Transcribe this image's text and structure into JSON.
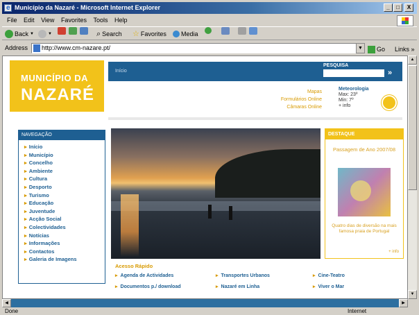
{
  "window": {
    "title": "Município da Nazaré - Microsoft Internet Explorer",
    "controls": [
      "_",
      "□",
      "X"
    ]
  },
  "menu": [
    "File",
    "Edit",
    "View",
    "Favorites",
    "Tools",
    "Help"
  ],
  "toolbar": {
    "back": "Back",
    "search": "Search",
    "favorites": "Favorites",
    "media": "Media"
  },
  "address": {
    "label": "Address",
    "url": "http://www.cm-nazare.pt/",
    "go": "Go",
    "links": "Links"
  },
  "status": {
    "text": "Done",
    "zone": "Internet"
  },
  "site": {
    "logo_line1": "MUNICÍPIO DA",
    "logo_line2": "NAZARÉ",
    "breadcrumb": "Início",
    "search_label": "PESQUISA",
    "search_go": "»",
    "top_links": [
      "Mapas",
      "Formulários Online",
      "Câmaras Online"
    ],
    "weather": {
      "title": "Meteorologia",
      "max": "Max: 23º",
      "min": "Min: 7º",
      "more": "+ info"
    },
    "nav_header": "NAVEGAÇÃO",
    "nav_items": [
      "Início",
      "Município",
      "Concelho",
      "Ambiente",
      "Cultura",
      "Desporto",
      "Turismo",
      "Educação",
      "Juventude",
      "Acção Social",
      "Colectividades",
      "Notícias",
      "Informações",
      "Contactos",
      "Galeria de Imagens"
    ],
    "destaque": {
      "header": "DESTAQUE",
      "title": "Passagem de Ano 2007/08",
      "desc": "Quatro dias de diversão na mais famosa praia de Portugal",
      "more": "+ info"
    },
    "acesso": {
      "header": "Acesso Rápido",
      "items": [
        "Agenda de Actividades",
        "Transportes Urbanos",
        "Cine-Teatro",
        "Documentos p./ download",
        "Nazaré em Linha",
        "Viver o Mar"
      ]
    }
  }
}
